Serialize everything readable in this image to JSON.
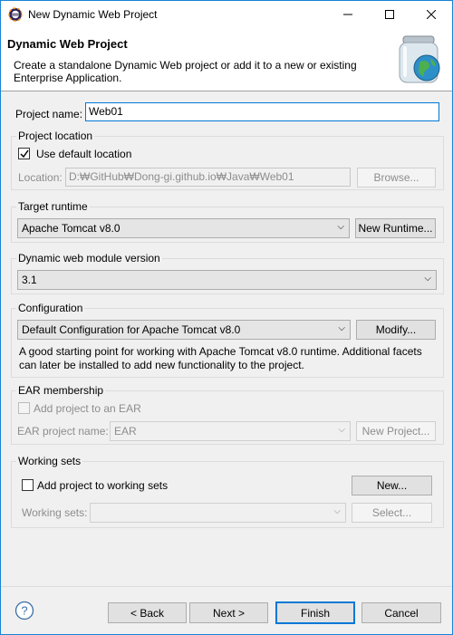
{
  "window": {
    "title": "New Dynamic Web Project"
  },
  "header": {
    "title": "Dynamic Web Project",
    "description": "Create a standalone Dynamic Web project or add it to a new or existing Enterprise Application."
  },
  "project_name": {
    "label": "Project name:",
    "value": "Web01"
  },
  "project_location": {
    "title": "Project location",
    "use_default_label": "Use default location",
    "use_default_checked": true,
    "location_label": "Location:",
    "location_value": "D:₩GitHub₩Dong-gi.github.io₩Java₩Web01",
    "browse_label": "Browse..."
  },
  "target_runtime": {
    "title": "Target runtime",
    "selected": "Apache Tomcat v8.0",
    "new_runtime_label": "New Runtime..."
  },
  "module_version": {
    "title": "Dynamic web module version",
    "selected": "3.1"
  },
  "configuration": {
    "title": "Configuration",
    "selected": "Default Configuration for Apache Tomcat v8.0",
    "modify_label": "Modify...",
    "description": "A good starting point for working with Apache Tomcat v8.0 runtime. Additional facets can later be installed to add new functionality to the project."
  },
  "ear": {
    "title": "EAR membership",
    "add_label": "Add project to an EAR",
    "add_checked": false,
    "name_label": "EAR project name:",
    "name_value": "EAR",
    "new_project_label": "New Project..."
  },
  "working_sets": {
    "title": "Working sets",
    "add_label": "Add project to working sets",
    "add_checked": false,
    "new_label": "New...",
    "sets_label": "Working sets:",
    "sets_value": "",
    "select_label": "Select..."
  },
  "footer": {
    "back_label": "< Back",
    "next_label": "Next >",
    "finish_label": "Finish",
    "cancel_label": "Cancel"
  },
  "colors": {
    "focus": "#0078d7",
    "titlebar": "#ffffff",
    "dialog_bg": "#f0f0f0"
  }
}
